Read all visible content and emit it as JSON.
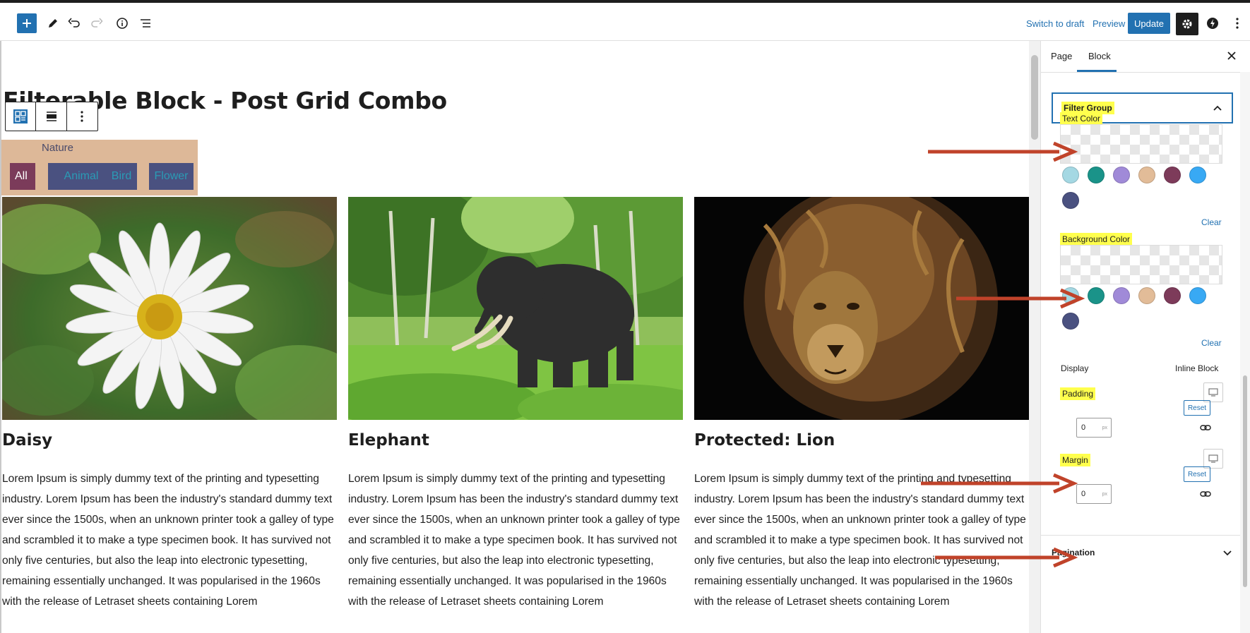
{
  "toolbar": {
    "switch_to_draft": "Switch to draft",
    "preview": "Preview",
    "update": "Update"
  },
  "page": {
    "title": "Filterable Block - Post Grid Combo"
  },
  "filter": {
    "group_label": "Nature",
    "buttons": [
      "All",
      "Animal",
      "Bird",
      "Flower"
    ],
    "colors": {
      "background": "#ddb898",
      "active": "#7b3b5a",
      "inactive": "#4a5180",
      "text": "#2a9bb5"
    }
  },
  "posts": [
    {
      "title": "Daisy",
      "excerpt": "Lorem Ipsum is simply dummy text of the printing and typesetting industry. Lorem Ipsum has been the industry's standard dummy text ever since the 1500s, when an unknown printer took a galley of type and scrambled it to make a type specimen book. It has survived not only five centuries, but also the leap into electronic typesetting, remaining essentially unchanged. It was popularised in the 1960s with the release of Letraset sheets containing Lorem"
    },
    {
      "title": "Elephant",
      "excerpt": "Lorem Ipsum is simply dummy text of the printing and typesetting industry. Lorem Ipsum has been the industry's standard dummy text ever since the 1500s, when an unknown printer took a galley of type and scrambled it to make a type specimen book. It has survived not only five centuries, but also the leap into electronic typesetting, remaining essentially unchanged. It was popularised in the 1960s with the release of Letraset sheets containing Lorem"
    },
    {
      "title": "Protected: Lion",
      "excerpt": "Lorem Ipsum is simply dummy text of the printing and typesetting industry. Lorem Ipsum has been the industry's standard dummy text ever since the 1500s, when an unknown printer took a galley of type and scrambled it to make a type specimen book. It has survived not only five centuries, but also the leap into electronic typesetting, remaining essentially unchanged. It was popularised in the 1960s with the release of Letraset sheets containing Lorem"
    }
  ],
  "sidebar": {
    "tabs": [
      "Page",
      "Block"
    ],
    "active_tab": "Block",
    "panel_title": "Filter Group",
    "text_color_label": "Text Color",
    "background_color_label": "Background Color",
    "palette": [
      "#a4d8e3",
      "#1a9389",
      "#a08ad8",
      "#e2bc98",
      "#7d3b5a",
      "#38a9f4",
      "#4a5180"
    ],
    "clear": "Clear",
    "display_label": "Display",
    "display_value": "Inline Block",
    "padding_label": "Padding",
    "margin_label": "Margin",
    "reset": "Reset",
    "padding_value": "0",
    "margin_value": "0",
    "unit": "px",
    "pagination": "Pagination"
  }
}
